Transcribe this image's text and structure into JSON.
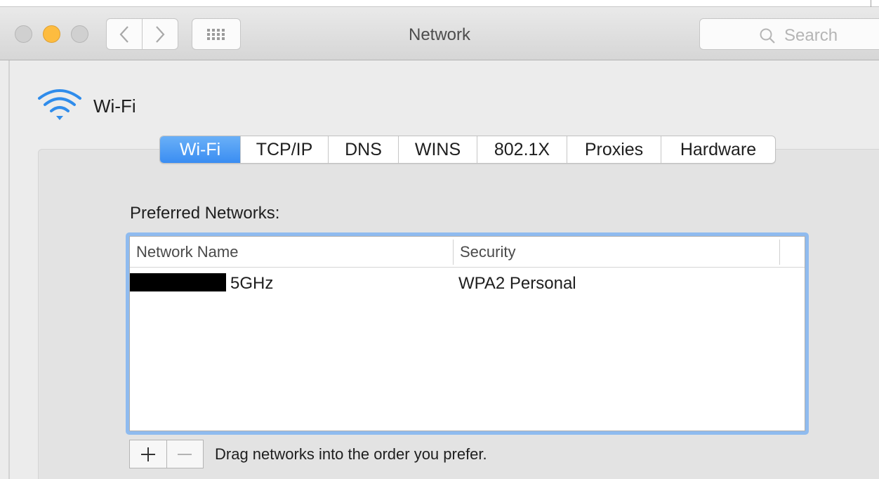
{
  "window": {
    "title": "Network",
    "search_placeholder": "Search"
  },
  "header": {
    "label": "Wi-Fi",
    "icon": "wifi-icon"
  },
  "tabs": [
    {
      "label": "Wi-Fi",
      "active": true
    },
    {
      "label": "TCP/IP",
      "active": false
    },
    {
      "label": "DNS",
      "active": false
    },
    {
      "label": "WINS",
      "active": false
    },
    {
      "label": "802.1X",
      "active": false
    },
    {
      "label": "Proxies",
      "active": false
    },
    {
      "label": "Hardware",
      "active": false
    }
  ],
  "preferred": {
    "label": "Preferred Networks:",
    "columns": [
      "Network Name",
      "Security"
    ],
    "rows": [
      {
        "name": "5GHz",
        "security": "WPA2 Personal",
        "name_redacted": true
      }
    ],
    "add_label": "+",
    "remove_label": "−",
    "hint": "Drag networks into the order you prefer."
  },
  "colors": {
    "accent": "#3a8df2",
    "min_button": "#fdbc40",
    "focus_ring": "#8fbbef"
  }
}
